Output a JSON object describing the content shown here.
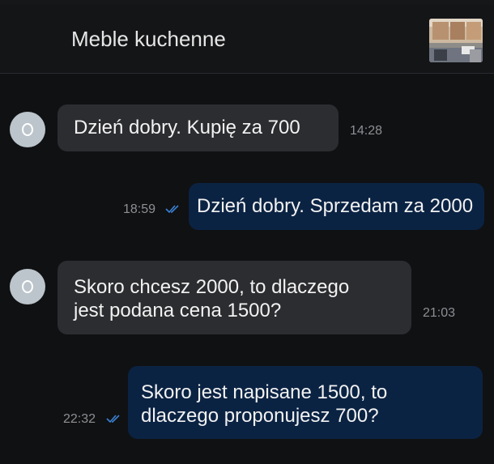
{
  "header": {
    "title": "Meble kuchenne"
  },
  "messages": [
    {
      "side": "in",
      "text": "Dzień dobry. Kupię za 700",
      "time": "14:28"
    },
    {
      "side": "out",
      "text": "Dzień dobry. Sprzedam za 2000",
      "time": "18:59",
      "read_icon": "double-check-icon"
    },
    {
      "side": "in",
      "line1": "Skoro chcesz 2000, to dlaczego",
      "line2": "jest podana cena 1500?",
      "time": "21:03"
    },
    {
      "side": "out",
      "line1": "Skoro jest napisane 1500, to",
      "line2": "dlaczego proponujesz 700?",
      "time": "22:32",
      "read_icon": "double-check-icon"
    }
  ],
  "colors": {
    "incoming_bubble": "#2c2d30",
    "outgoing_bubble": "#0b2343",
    "read_check": "#3b82d6",
    "avatar": "#bcc5cc"
  }
}
